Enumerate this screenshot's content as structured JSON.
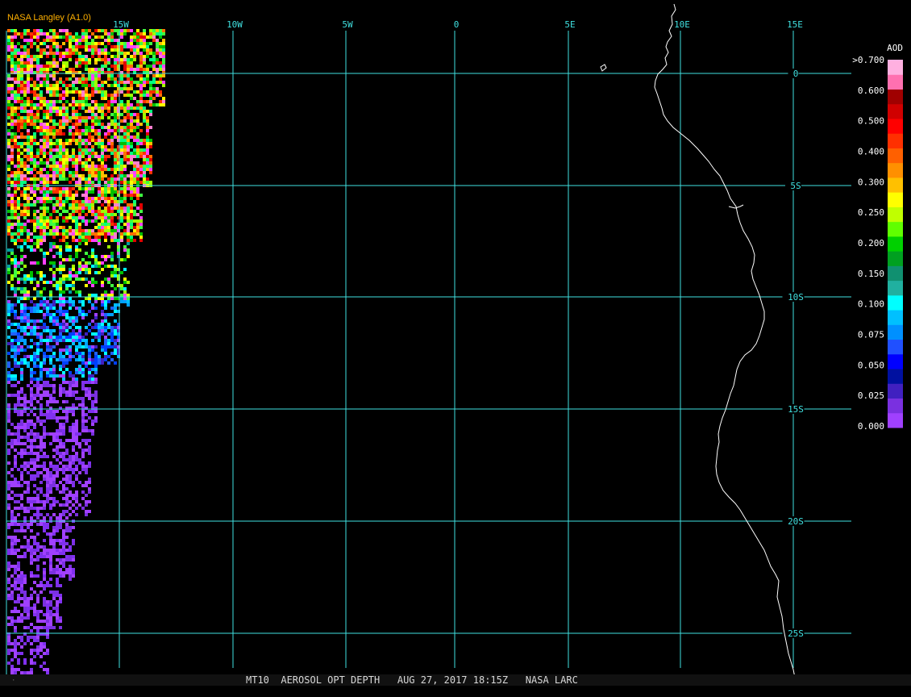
{
  "credit": "NASA Langley (A1.0)",
  "footer": "MT10  AEROSOL OPT DEPTH   AUG 27, 2017 18:15Z   NASA LARC",
  "colors": {
    "background": "#000000",
    "grid": "#40e0e0",
    "coast": "#ffffff",
    "credit": "#ffb000"
  },
  "map": {
    "lon_labels": [
      "15W",
      "10W",
      "5W",
      "0",
      "5E",
      "10E",
      "15E"
    ],
    "lat_labels": [
      "0",
      "5S",
      "10S",
      "15S",
      "20S",
      "25S"
    ]
  },
  "legend": {
    "title": "AOD",
    "ticks": [
      ">0.700",
      "0.600",
      "0.500",
      "0.400",
      "0.300",
      "0.250",
      "0.200",
      "0.150",
      "0.100",
      "0.075",
      "0.050",
      "0.025",
      "0.000"
    ],
    "colors": [
      "#a040ff",
      "#7a30e0",
      "#4020c0",
      "#0010a0",
      "#0000ff",
      "#2050ff",
      "#0090ff",
      "#00c0ff",
      "#00ffff",
      "#20b0a0",
      "#109070",
      "#00a020",
      "#00d000",
      "#60ff00",
      "#c0ff00",
      "#ffff00",
      "#ffc000",
      "#ff9000",
      "#ff6000",
      "#ff3000",
      "#ff0000",
      "#d00000",
      "#a00000",
      "#ff70b0",
      "#ffb0e0"
    ]
  }
}
